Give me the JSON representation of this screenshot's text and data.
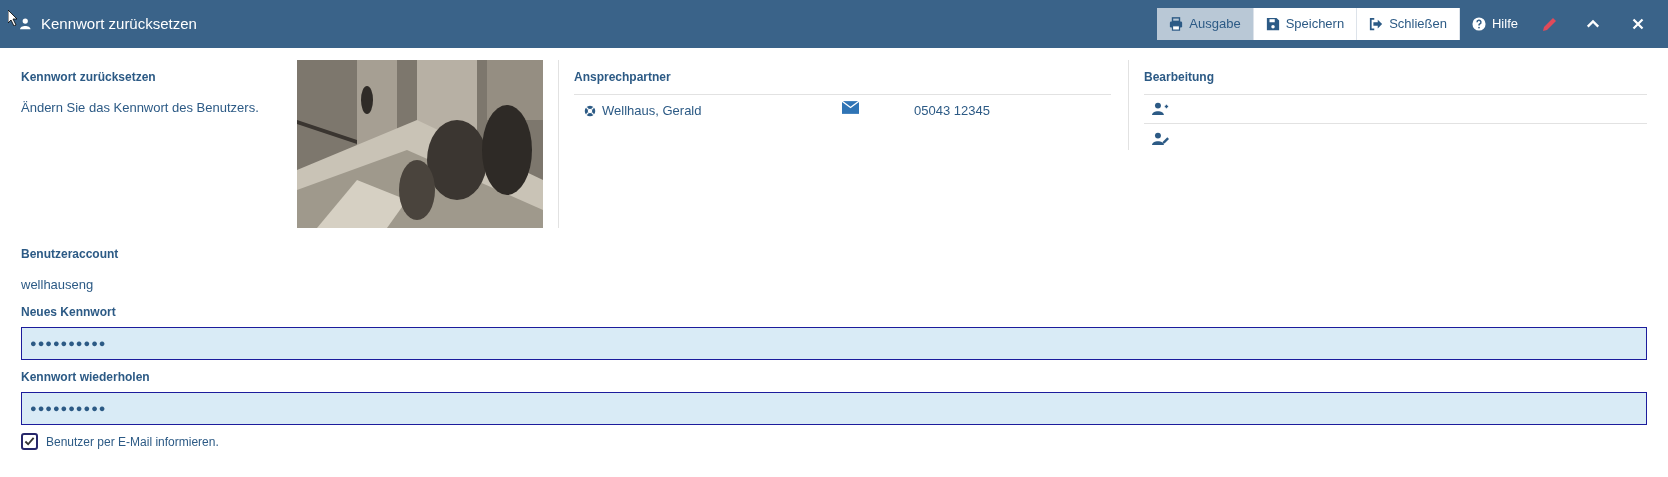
{
  "window": {
    "title": "Kennwort zurücksetzen"
  },
  "toolbar": [
    {
      "label": "Ausgabe",
      "kind": "print",
      "selected": true
    },
    {
      "label": "Speichern",
      "kind": "save",
      "selected": false
    },
    {
      "label": "Schließen",
      "kind": "exit",
      "selected": false
    }
  ],
  "help": {
    "label": "Hilfe"
  },
  "intro": {
    "title": "Kennwort zurücksetzen",
    "text": "Ändern Sie das Kennwort des Benutzers."
  },
  "contacts": {
    "title": "Ansprechpartner",
    "rows": [
      {
        "name": "Wellhaus, Gerald",
        "phone": "05043 12345"
      }
    ]
  },
  "editing": {
    "title": "Bearbeitung",
    "actions": [
      {
        "kind": "add-user"
      },
      {
        "kind": "edit-user"
      }
    ]
  },
  "account": {
    "label": "Benutzeraccount",
    "value": "wellhauseng"
  },
  "fields": [
    {
      "label": "Neues Kennwort",
      "value": "●●●●●●●●●●"
    },
    {
      "label": "Kennwort wiederholen",
      "value": "●●●●●●●●●●"
    }
  ],
  "notify": {
    "label": "Benutzer per E-Mail informieren.",
    "checked": true
  }
}
